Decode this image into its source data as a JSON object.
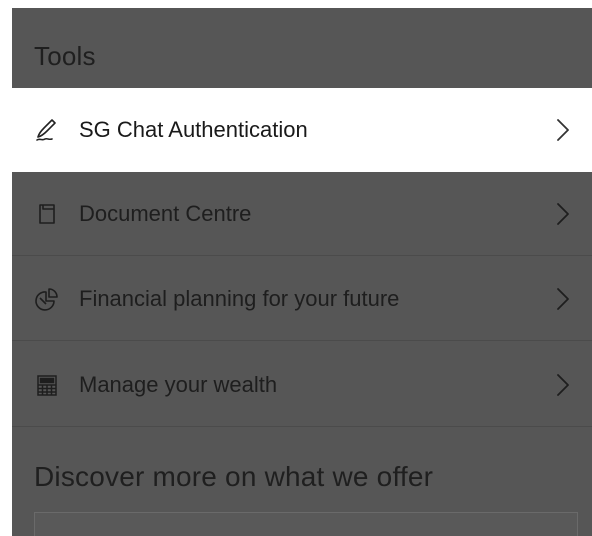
{
  "tools": {
    "title": "Tools",
    "items": [
      {
        "label": "SG Chat Authentication",
        "icon": "signature-icon",
        "selected": true
      },
      {
        "label": "Document Centre",
        "icon": "document-icon",
        "selected": false
      },
      {
        "label": "Financial planning for your future",
        "icon": "pie-chart-icon",
        "selected": false
      },
      {
        "label": "Manage your wealth",
        "icon": "calculator-icon",
        "selected": false
      }
    ]
  },
  "discover": {
    "title": "Discover more on what we offer"
  },
  "colors": {
    "overlay": "#565656",
    "selected_background": "#ffffff",
    "text_dark": "#1e1e1e"
  }
}
